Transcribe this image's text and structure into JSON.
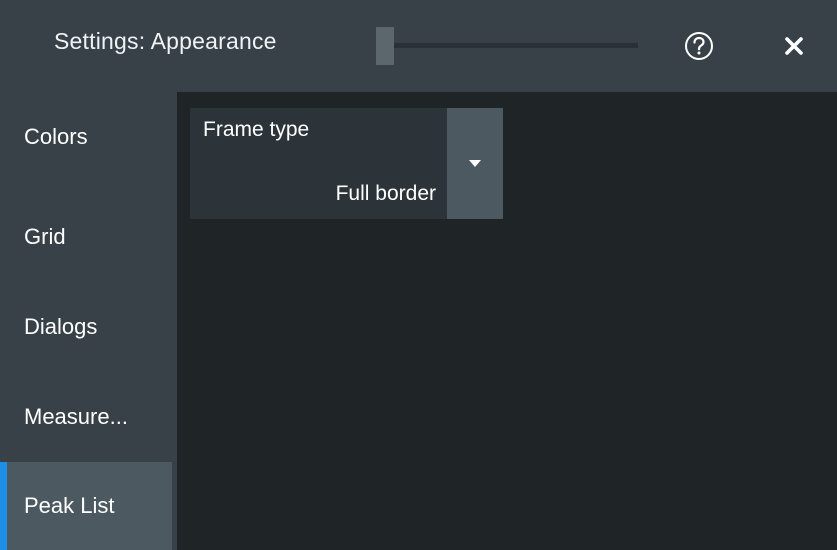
{
  "titlebar": {
    "title": "Settings: Appearance",
    "help_icon": "question-circle-icon",
    "close_icon": "close-x-icon"
  },
  "sidebar": {
    "items": [
      {
        "label": "Colors",
        "active": false
      },
      {
        "label": "Grid",
        "active": false
      },
      {
        "label": "Dialogs",
        "active": false
      },
      {
        "label": "Measure...",
        "active": false
      },
      {
        "label": "Peak List",
        "active": true
      }
    ]
  },
  "main": {
    "frame_type": {
      "label": "Frame type",
      "value": "Full border",
      "dropdown_icon": "caret-down-icon"
    }
  },
  "colors": {
    "accent": "#1e8fe6",
    "titlebar_bg": "#384147",
    "content_bg": "#1f2427"
  }
}
